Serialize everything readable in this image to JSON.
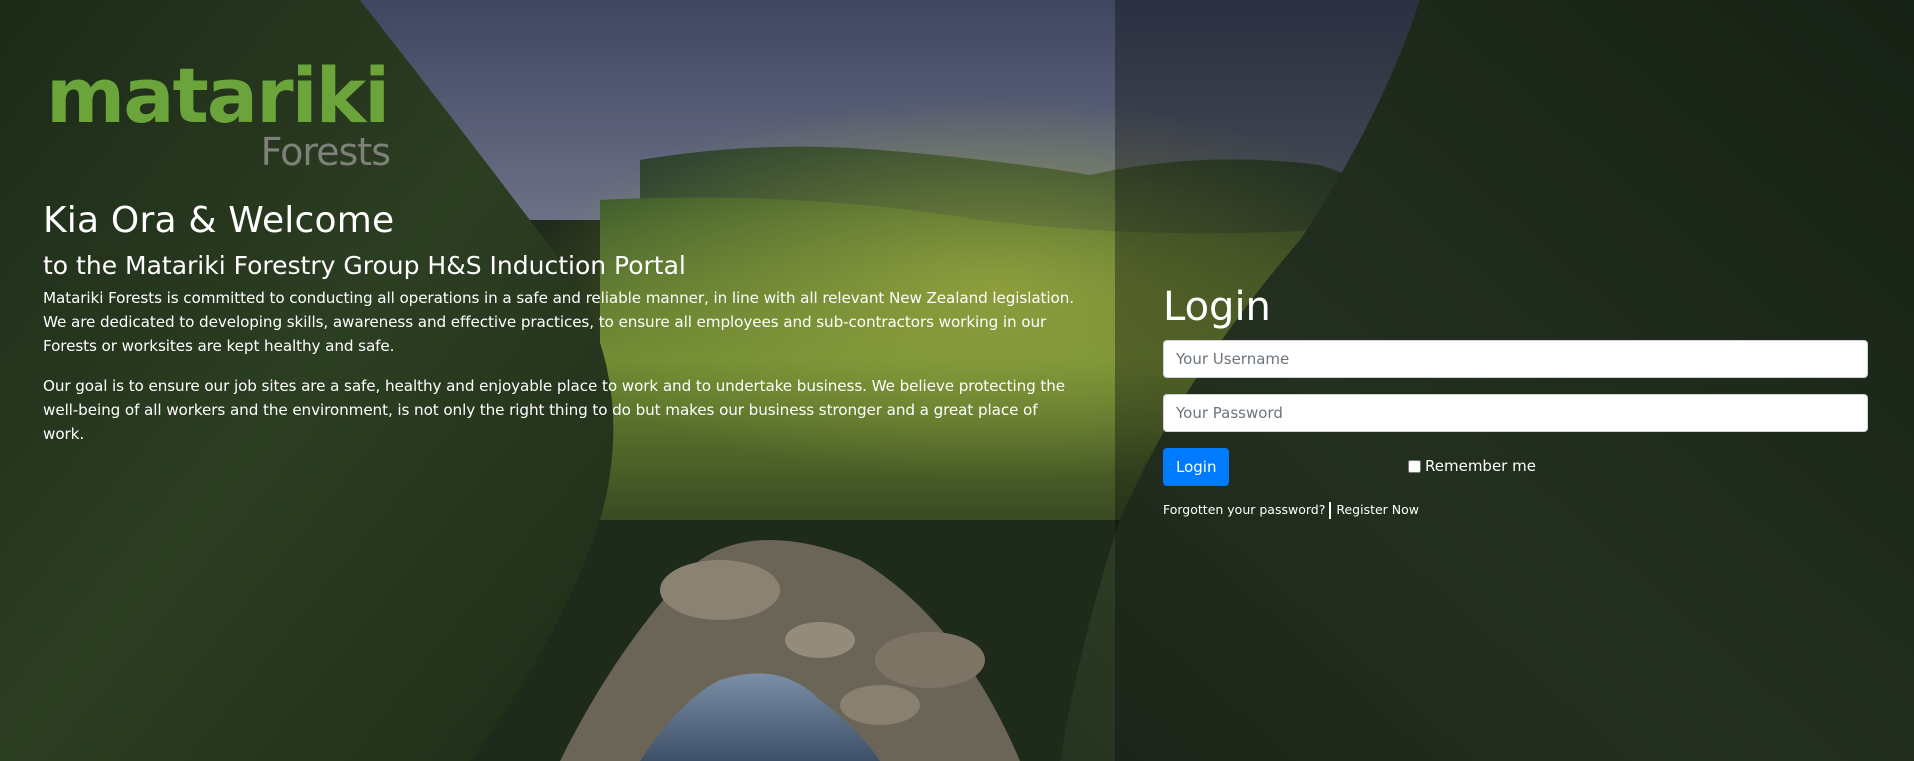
{
  "brand": {
    "logo_main": "matariki",
    "logo_sub": "Forests"
  },
  "welcome": {
    "heading": "Kia Ora & Welcome",
    "subheading": "to the Matariki Forestry Group H&S Induction Portal",
    "paragraph_1": "Matariki Forests is committed to conducting all operations in a safe and reliable manner, in line with all relevant New Zealand legislation.  We are dedicated to developing skills, awareness and effective practices, to ensure all employees and sub-contractors working in our Forests or worksites are kept healthy and safe.",
    "paragraph_2": "Our goal is to ensure our job sites are a safe, healthy and enjoyable place to work and to undertake business.  We believe protecting the well-being of all workers and the environment, is not only the right thing to do but makes our business stronger and a great place of work."
  },
  "login": {
    "title": "Login",
    "username_placeholder": "Your Username",
    "password_placeholder": "Your Password",
    "submit_label": "Login",
    "remember_label": "Remember me",
    "remember_checked": false,
    "forgot_label": "Forgotten your password?",
    "register_label": "Register Now"
  },
  "colors": {
    "brand_green": "#6aa43a",
    "brand_grey": "#7e8179",
    "button_blue": "#007bff"
  }
}
